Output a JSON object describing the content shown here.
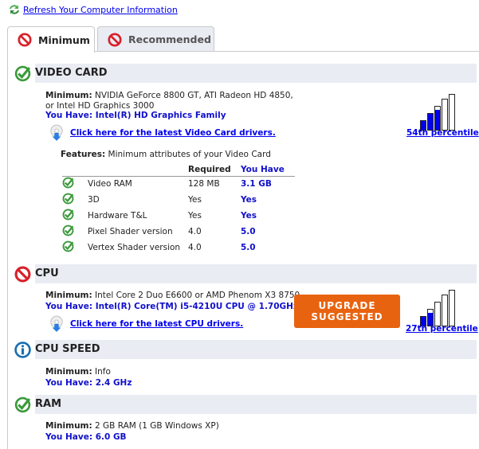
{
  "refresh_link": "Refresh Your Computer Information",
  "tabs": [
    {
      "label": "Minimum",
      "active": true
    },
    {
      "label": "Recommended",
      "active": false
    }
  ],
  "video_card": {
    "title": "VIDEO CARD",
    "status": "pass",
    "minimum_label": "Minimum:",
    "minimum": "NVIDIA GeForce 8800 GT, ATI Radeon HD 4850, or Intel HD Graphics 3000",
    "you_have_label": "You Have:",
    "you_have": "Intel(R) HD Graphics Family",
    "driver_link": "Click here for the latest Video Card drivers.",
    "percentile": "54th percentile",
    "bar_fill": [
      1,
      1,
      0.85,
      0,
      0
    ],
    "features_label": "Features:",
    "features_desc": "Minimum attributes of your Video Card",
    "col_required": "Required",
    "col_you_have": "You Have",
    "features": [
      {
        "name": "Video RAM",
        "required": "128 MB",
        "have": "3.1 GB"
      },
      {
        "name": "3D",
        "required": "Yes",
        "have": "Yes"
      },
      {
        "name": "Hardware T&L",
        "required": "Yes",
        "have": "Yes"
      },
      {
        "name": "Pixel Shader version",
        "required": "4.0",
        "have": "5.0"
      },
      {
        "name": "Vertex Shader version",
        "required": "4.0",
        "have": "5.0"
      }
    ]
  },
  "cpu": {
    "title": "CPU",
    "status": "fail",
    "minimum_label": "Minimum:",
    "minimum": "Intel Core 2 Duo E6600 or AMD Phenom X3 8750",
    "you_have_label": "You Have:",
    "you_have": "Intel(R) Core(TM) i5-4210U CPU @ 1.70GHz",
    "driver_link": "Click here for the latest CPU drivers.",
    "upgrade_line1": "UPGRADE",
    "upgrade_line2": "SUGGESTED",
    "percentile": "27th percentile",
    "bar_fill": [
      1,
      0.8,
      0,
      0,
      0
    ]
  },
  "cpu_speed": {
    "title": "CPU SPEED",
    "status": "info",
    "minimum_label": "Minimum:",
    "minimum": "Info",
    "you_have_label": "You Have:",
    "you_have": "2.4 GHz"
  },
  "ram": {
    "title": "RAM",
    "status": "pass",
    "minimum_label": "Minimum:",
    "minimum": "2 GB RAM (1 GB Windows XP)",
    "you_have_label": "You Have:",
    "you_have": "6.0 GB"
  },
  "colors": {
    "accent_blue": "#0000ee",
    "upgrade": "#e8630f",
    "pass": "#3a9a3a",
    "fail": "#d9202a",
    "info": "#1a6fb0"
  }
}
